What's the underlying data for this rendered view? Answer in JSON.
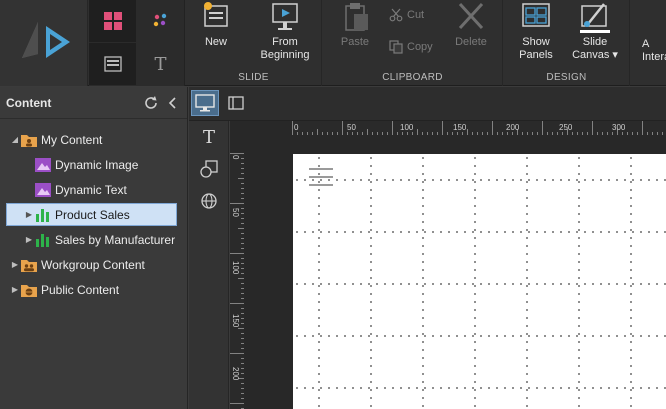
{
  "ribbon": {
    "slide": {
      "group_label": "SLIDE",
      "new_label": "New",
      "from_beginning_label": "From\nBeginning"
    },
    "clipboard": {
      "group_label": "CLIPBOARD",
      "paste_label": "Paste",
      "cut_label": "Cut",
      "copy_label": "Copy",
      "delete_label": "Delete"
    },
    "design": {
      "group_label": "DESIGN",
      "show_panels_label": "Show\nPanels",
      "slide_canvas_label": "Slide\nCanvas ▾"
    },
    "interactions_partial_label": "A\nIntera"
  },
  "panel": {
    "title": "Content",
    "items": [
      {
        "label": "My Content",
        "level": 0,
        "expanded": true,
        "icon": "folder-user-icon"
      },
      {
        "label": "Dynamic Image",
        "level": 1,
        "icon": "dynamic-image-icon"
      },
      {
        "label": "Dynamic Text",
        "level": 1,
        "icon": "dynamic-text-icon"
      },
      {
        "label": "Product Sales",
        "level": 1,
        "icon": "bar-chart-icon",
        "selected": true
      },
      {
        "label": "Sales by Manufacturer",
        "level": 1,
        "icon": "bar-chart-icon"
      },
      {
        "label": "Workgroup Content",
        "level": 0,
        "icon": "folder-group-icon"
      },
      {
        "label": "Public Content",
        "level": 0,
        "icon": "folder-globe-icon"
      }
    ]
  },
  "ruler": {
    "h_ticks": [
      "0",
      "50",
      "100",
      "150",
      "200",
      "250",
      "300"
    ],
    "v_ticks": [
      "0",
      "50",
      "100",
      "150",
      "200"
    ]
  },
  "colors": {
    "accent": "#4aa3d6",
    "selection": "#cfe1f5",
    "chart_green": "#2db34a",
    "folder_orange": "#e8a34c",
    "purple": "#9b4fc6"
  }
}
